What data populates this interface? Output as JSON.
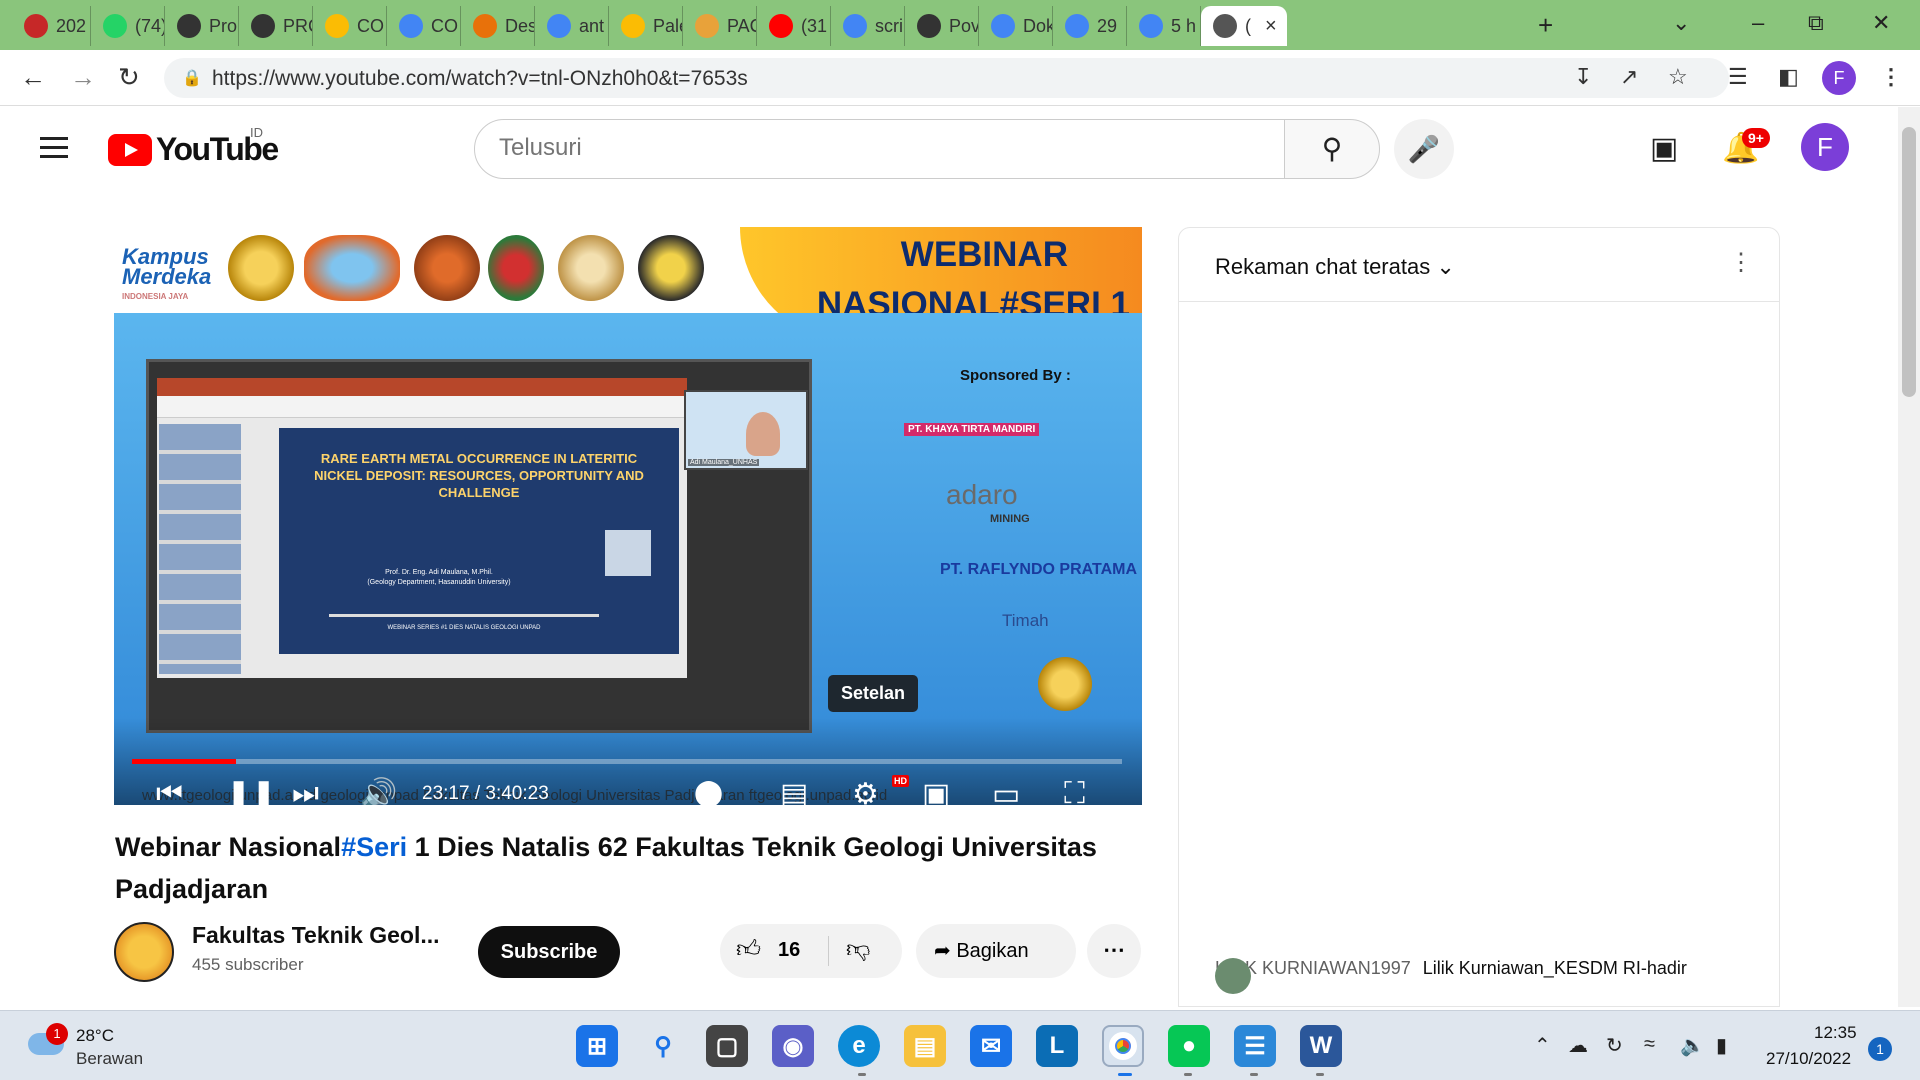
{
  "tabs": [
    {
      "label": "202",
      "icon": "live-icon",
      "color": "#c62828"
    },
    {
      "label": "(74)",
      "icon": "whatsapp-icon",
      "color": "#25d366"
    },
    {
      "label": "Pro",
      "icon": "globe-icon",
      "color": "#333333"
    },
    {
      "label": "PRC",
      "icon": "globe-icon",
      "color": "#333333"
    },
    {
      "label": "CO",
      "icon": "drive-icon",
      "color": "#fbbc04"
    },
    {
      "label": "CO",
      "icon": "docs-icon",
      "color": "#4285f4"
    },
    {
      "label": "Des",
      "icon": "design-icon",
      "color": "#e8710a"
    },
    {
      "label": "ant",
      "icon": "google-icon",
      "color": "#4285f4"
    },
    {
      "label": "Pale",
      "icon": "drive-icon",
      "color": "#fbbc04"
    },
    {
      "label": "PAC",
      "icon": "emblem-icon",
      "color": "#e8a23a"
    },
    {
      "label": "(31",
      "icon": "youtube-icon",
      "color": "#ff0000"
    },
    {
      "label": "scri",
      "icon": "google-icon",
      "color": "#4285f4"
    },
    {
      "label": "Pov",
      "icon": "globe-icon",
      "color": "#333333"
    },
    {
      "label": "Dok",
      "icon": "docs-icon",
      "color": "#4285f4"
    },
    {
      "label": "29",
      "icon": "google-icon",
      "color": "#4285f4"
    },
    {
      "label": "5 h",
      "icon": "google-icon",
      "color": "#4285f4"
    },
    {
      "label": "(",
      "icon": "audio-icon",
      "color": "#555555",
      "active": true
    }
  ],
  "browser": {
    "url": "https://www.youtube.com/watch?v=tnl-ONzh0h0&t=7653s",
    "profile_initial": "F"
  },
  "youtube": {
    "logo_text": "YouTube",
    "country": "ID",
    "search_placeholder": "Telusuri",
    "notification_count": "9+",
    "avatar_initial": "F"
  },
  "video": {
    "banner_line1": "WEBINAR",
    "banner_line2": "NASIONAL#SERI 1",
    "kampus_line1": "Kampus",
    "kampus_line2": "Merdeka",
    "kampus_sub": "INDONESIA JAYA",
    "slide_title": "RARE EARTH METAL OCCURRENCE IN LATERITIC NICKEL DEPOSIT: RESOURCES, OPPORTUNITY AND CHALLENGE",
    "slide_author": "Prof. Dr. Eng. Adi Maulana, M.Phil.",
    "slide_affiliation": "(Geology Department, Hasanuddin University)",
    "slide_series": "WEBINAR SERIES #1 DIES NATALIS GEOLOGI UNPAD",
    "cam_label": "Adi Maulana_UNHAS",
    "sponsored_by": "Sponsored By :",
    "sponsors": [
      "PT. KHAYA TIRTA MANDIRI",
      "adaro",
      "MINING",
      "PT. RAFLYNDO PRATAMA",
      "Timah"
    ],
    "tooltip": "Setelan",
    "time_current": "23:17",
    "time_total": "3:40:23",
    "progress_fraction": 0.105,
    "hd_badge": "HD",
    "overlay_text": "www.ftgeologi.unpad.ac.id   geologi_unpad   Fakultas Teknik Geologi Universitas Padjadjaran   ftgeologi.unpad.ac.id"
  },
  "meta": {
    "title_part1": "Webinar Nasional",
    "title_tag": "#Seri",
    "title_part2": " 1 Dies Natalis 62 Fakultas Teknik Geologi Universitas Padjadjaran",
    "channel_name": "Fakultas Teknik Geol...",
    "subscribers": "455 subscriber",
    "subscribe_label": "Subscribe",
    "likes": "16",
    "share_label": "Bagikan"
  },
  "chat": {
    "title": "Rekaman chat teratas",
    "author": "LILIK KURNIAWAN1997",
    "message": "Lilik Kurniawan_KESDM RI-hadir"
  },
  "taskbar": {
    "weather_badge": "1",
    "temperature": "28°C",
    "weather": "Berawan",
    "time": "12:35",
    "date": "27/10/2022",
    "notification_count": "1"
  }
}
